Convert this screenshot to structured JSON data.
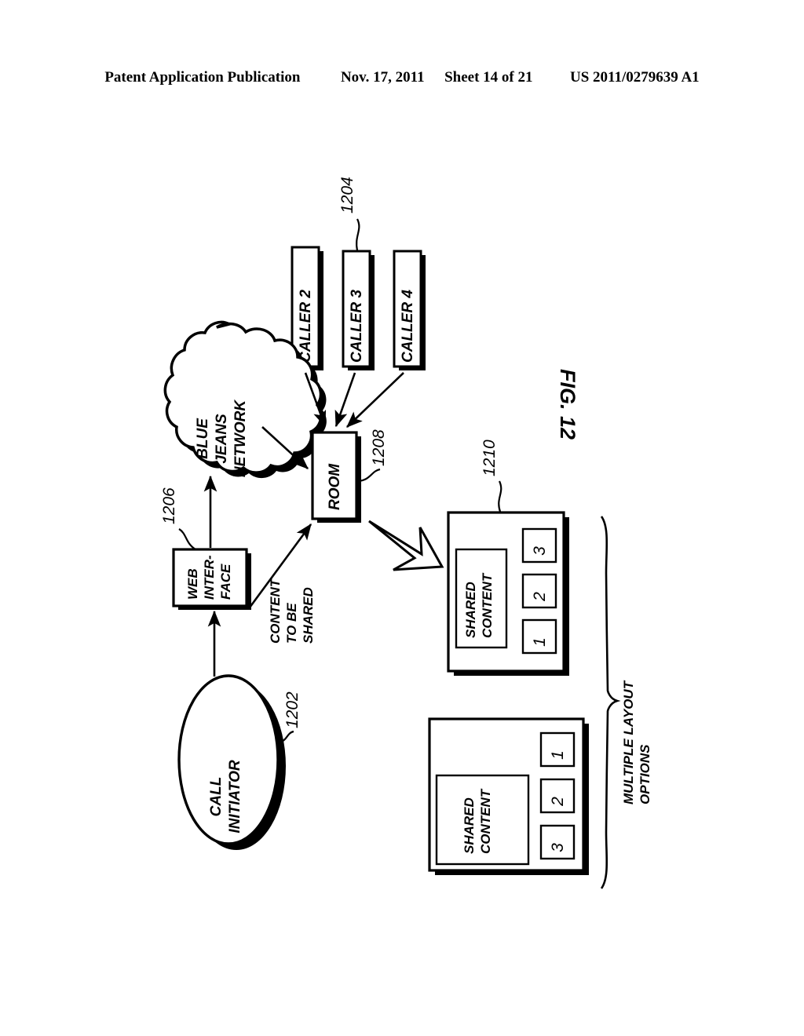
{
  "header": {
    "publication": "Patent Application Publication",
    "date": "Nov. 17, 2011",
    "sheet": "Sheet 14 of 21",
    "patent_number": "US 2011/0279639 A1"
  },
  "figure": {
    "caption": "FIG. 12",
    "nodes": {
      "call_initiator": {
        "label_line1": "CALL",
        "label_line2": "INITIATOR",
        "ref": "1202"
      },
      "web_interface": {
        "label_line1": "WEB",
        "label_line2": "INTER-",
        "label_line3": "FACE",
        "ref": "1206"
      },
      "network_cloud": {
        "label_line1": "BLUE",
        "label_line2": "JEANS",
        "label_line3": "NETWORK"
      },
      "room": {
        "label": "ROOM",
        "ref": "1208"
      },
      "callers": {
        "ref": "1204",
        "items": [
          "CALLER 2",
          "CALLER 3",
          "CALLER 4"
        ]
      }
    },
    "edges": {
      "content_to_be_shared": {
        "line1": "CONTENT",
        "line2": "TO BE",
        "line3": "SHARED"
      }
    },
    "layouts": {
      "ref": "1210",
      "bracket_label_line1": "MULTIPLE LAYOUT",
      "bracket_label_line2": "OPTIONS",
      "option_a": {
        "shared_content_line1": "SHARED",
        "shared_content_line2": "CONTENT",
        "thumbnails": [
          "1",
          "2",
          "3"
        ]
      },
      "option_b": {
        "shared_content_line1": "SHARED",
        "shared_content_line2": "CONTENT",
        "thumbnails": [
          "1",
          "2",
          "3"
        ]
      }
    }
  }
}
